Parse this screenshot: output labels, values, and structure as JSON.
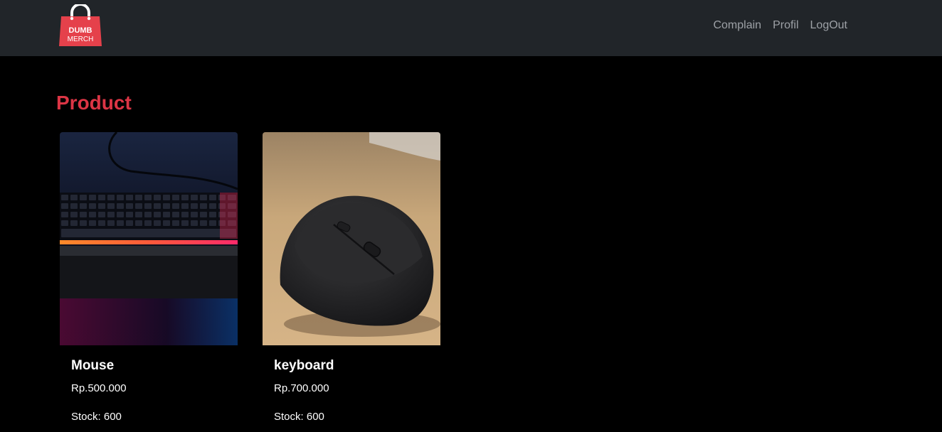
{
  "navbar": {
    "logo": {
      "line1": "DUMB",
      "line2": "MERCH",
      "icon": "shopping-bag-logo"
    },
    "links": {
      "complain": "Complain",
      "profil": "Profil",
      "logout": "LogOut"
    }
  },
  "main": {
    "title": "Product",
    "products": [
      {
        "name": "Mouse",
        "price": "Rp.500.000",
        "stock": "Stock: 600",
        "image": "keyboard-photo"
      },
      {
        "name": "keyboard",
        "price": "Rp.700.000",
        "stock": "Stock: 600",
        "image": "mouse-photo"
      }
    ]
  },
  "colors": {
    "navbar_bg": "#212529",
    "page_bg": "#000000",
    "accent": "#dc3545",
    "nav_text": "#9da1a6",
    "text": "#ffffff"
  }
}
